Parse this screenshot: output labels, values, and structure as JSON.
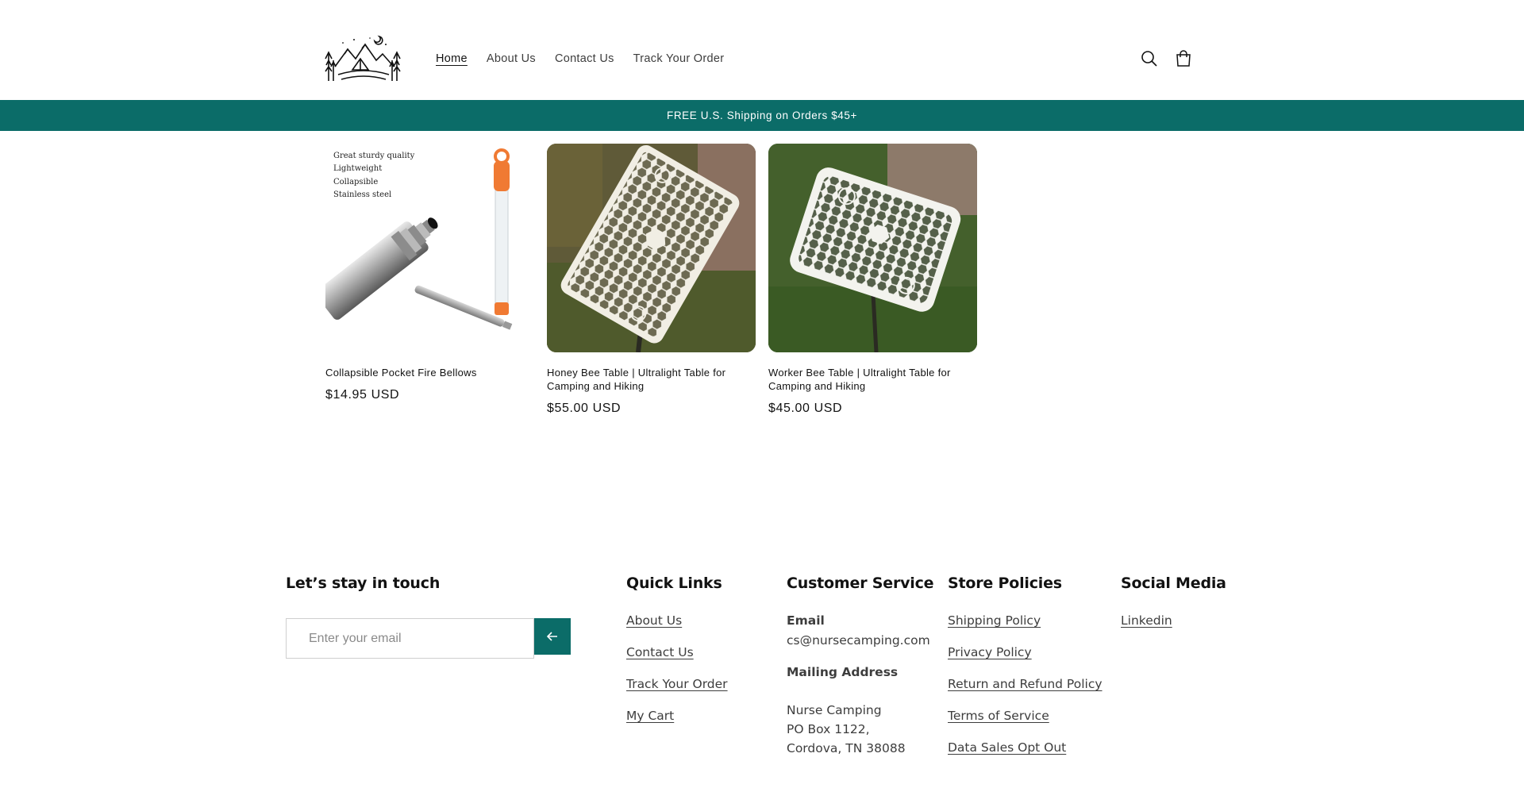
{
  "header": {
    "nav": [
      {
        "label": "Home"
      },
      {
        "label": "About Us"
      },
      {
        "label": "Contact Us"
      },
      {
        "label": "Track Your Order"
      }
    ],
    "icons": [
      "search-icon",
      "cart-icon"
    ]
  },
  "announcement": {
    "text": "FREE U.S. Shipping on Orders $45+"
  },
  "products": [
    {
      "title": "Collapsible Pocket Fire Bellows",
      "price": "$14.95 USD",
      "image_text": [
        "Great  sturdy quality",
        "Lightweight",
        "Collapsible",
        "Stainless steel"
      ]
    },
    {
      "title": "Honey Bee Table | Ultralight Table for Camping and Hiking",
      "price": "$55.00 USD"
    },
    {
      "title": "Worker Bee Table | Ultralight Table for Camping and Hiking",
      "price": "$45.00 USD"
    }
  ],
  "footer": {
    "newsletter": {
      "heading": "Let’s stay in touch",
      "placeholder": "Enter your email"
    },
    "quick_links": {
      "heading": "Quick Links",
      "links": [
        "About Us",
        "Contact Us",
        "Track Your Order",
        "My Cart"
      ]
    },
    "customer_service": {
      "heading": "Customer Service",
      "email_label": "Email",
      "email": "cs@nursecamping.com",
      "mailing_label": "Mailing Address",
      "address": [
        "Nurse Camping",
        "PO Box 1122,",
        "Cordova, TN 38088"
      ]
    },
    "store_policies": {
      "heading": "Store Policies",
      "links": [
        "Shipping Policy",
        "Privacy Policy",
        "Return and Refund Policy",
        "Terms of Service",
        "Data Sales Opt Out"
      ]
    },
    "social_media": {
      "heading": "Social Media",
      "links": [
        "Linkedin"
      ]
    }
  },
  "colors": {
    "accent": "#0b6c68",
    "text": "#121212",
    "muted": "#3d3d3d"
  }
}
